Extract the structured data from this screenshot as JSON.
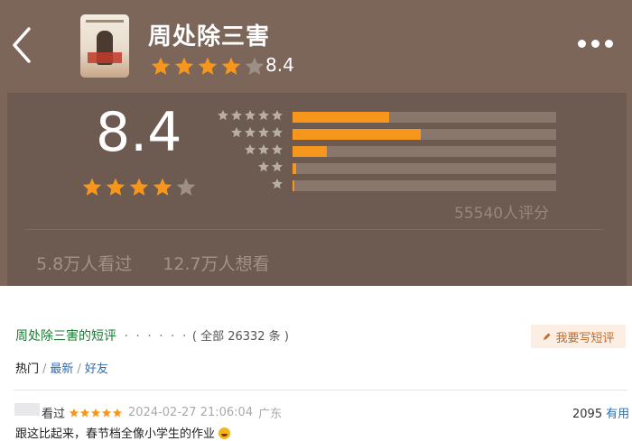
{
  "header": {
    "title": "周处除三害",
    "rating": "8.4",
    "stars_filled": 4,
    "stars_total": 5
  },
  "summary": {
    "score": "8.4",
    "stars_filled": 4,
    "stars_total": 5,
    "distribution": [
      {
        "stars": 5,
        "fraction": 0.366
      },
      {
        "stars": 4,
        "fraction": 0.485
      },
      {
        "stars": 3,
        "fraction": 0.13
      },
      {
        "stars": 2,
        "fraction": 0.012
      },
      {
        "stars": 1,
        "fraction": 0.007
      }
    ],
    "rating_count": "55540人评分",
    "watched": "5.8万人看过",
    "wish": "12.7万人想看"
  },
  "reviews": {
    "title": "周处除三害的短评",
    "dots": "· · · · · ·",
    "all_count": "( 全部 26332 条 )",
    "write_label": "我要写短评",
    "tabs": [
      "热门",
      "最新",
      "好友"
    ],
    "tab_sep": "/",
    "item": {
      "watched_label": "看过",
      "stars": 5,
      "time": "2024-02-27 21:06:04",
      "location": "广东",
      "votes": "2095",
      "useful_label": "有用",
      "text": "跟这比起来，春节档全像小学生的作业"
    }
  },
  "colors": {
    "header_bg": "#7b6659",
    "panel_bg": "#6d5b51",
    "star_on": "#f6961c",
    "star_off": "#9c8f86",
    "bar_fill": "#f6961c",
    "bar_track": "#8a776b",
    "link": "#2f6dab",
    "section_title": "#1f7a35"
  },
  "icons": {
    "back": "chevron-left-icon",
    "more": "more-dots-icon",
    "write": "pencil-icon"
  }
}
